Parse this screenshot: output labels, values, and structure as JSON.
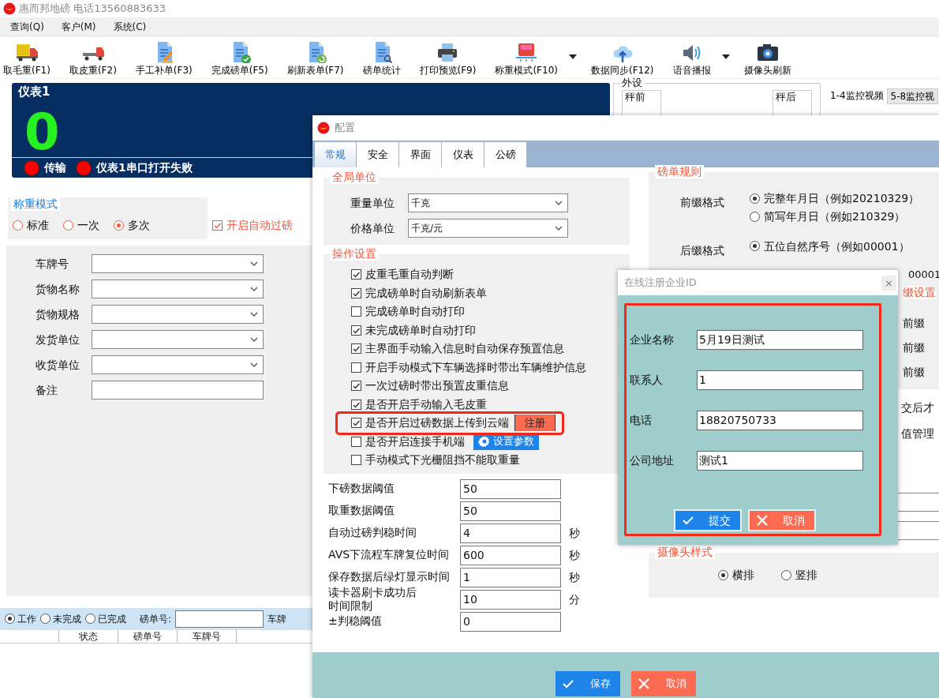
{
  "app": {
    "title": "惠而邦地磅 电话13560883633"
  },
  "menu": [
    "查询(Q)",
    "客户(M)",
    "系统(C)"
  ],
  "toolbar": [
    {
      "label": "取毛重(F1)",
      "kind": "cargo-truck",
      "dropdown": false
    },
    {
      "label": "取皮重(F2)",
      "kind": "flatbed-truck",
      "dropdown": false
    },
    {
      "label": "手工补单(F3)",
      "kind": "doc-pen",
      "dropdown": false
    },
    {
      "label": "完成磅单(F5)",
      "kind": "doc-check",
      "dropdown": false
    },
    {
      "label": "刷新表单(F7)",
      "kind": "doc-refresh",
      "dropdown": false
    },
    {
      "label": "磅单统计",
      "kind": "doc-search",
      "dropdown": false
    },
    {
      "label": "打印预览(F9)",
      "kind": "printer",
      "dropdown": false
    },
    {
      "label": "称重模式(F10)",
      "kind": "truck-front",
      "dropdown": true
    },
    {
      "label": "数据同步(F12)",
      "kind": "cloud-upload",
      "dropdown": false
    },
    {
      "label": "语音播报",
      "kind": "speaker",
      "dropdown": true
    },
    {
      "label": "摄像头刷新",
      "kind": "camera",
      "dropdown": false
    }
  ],
  "meter": {
    "title": "仪表1",
    "reading": "0",
    "indicators": [
      "传输",
      "仪表1串口打开失败"
    ]
  },
  "weigh_mode": {
    "title": "称重模式",
    "options": [
      {
        "label": "标准",
        "selected": false
      },
      {
        "label": "一次",
        "selected": false
      },
      {
        "label": "多次",
        "selected": true
      }
    ]
  },
  "auto_pass": {
    "label": "开启自动过磅",
    "checked": true
  },
  "form": {
    "fields": [
      {
        "label": "车牌号",
        "kind": "combo"
      },
      {
        "label": "货物名称",
        "kind": "combo"
      },
      {
        "label": "货物规格",
        "kind": "combo"
      },
      {
        "label": "发货单位",
        "kind": "combo"
      },
      {
        "label": "收货单位",
        "kind": "combo"
      },
      {
        "label": "备注",
        "kind": "text"
      }
    ]
  },
  "peripherals": {
    "title": "外设",
    "before": "秤前",
    "after": "秤后"
  },
  "video_tabs": [
    {
      "label": "1-4监控视频",
      "selected": true
    },
    {
      "label": "5-8监控视",
      "selected": false
    }
  ],
  "list_filter": {
    "options": [
      {
        "label": "工作",
        "selected": true
      },
      {
        "label": "未完成",
        "selected": false
      },
      {
        "label": "已完成",
        "selected": false
      }
    ],
    "bill_label": "磅单号:",
    "plate_label": "车牌"
  },
  "table": {
    "columns": [
      "",
      "状态",
      "磅单号",
      "车牌号"
    ]
  },
  "config": {
    "title": "配置",
    "tabs": [
      {
        "label": "常规",
        "selected": true
      },
      {
        "label": "安全",
        "selected": false
      },
      {
        "label": "界面",
        "selected": false
      },
      {
        "label": "仪表",
        "selected": false
      },
      {
        "label": "公磅",
        "selected": false
      }
    ],
    "global_units": {
      "title": "全局单位",
      "fields": [
        {
          "label": "重量单位",
          "value": "千克"
        },
        {
          "label": "价格单位",
          "value": "千克/元"
        }
      ]
    },
    "operations": {
      "title": "操作设置",
      "items": [
        {
          "label": "皮重毛重自动判断",
          "checked": true,
          "highlighted": false
        },
        {
          "label": "完成磅单时自动刷新表单",
          "checked": true,
          "highlighted": false
        },
        {
          "label": "完成磅单时自动打印",
          "checked": false,
          "highlighted": false
        },
        {
          "label": "未完成磅单时自动打印",
          "checked": true,
          "highlighted": false
        },
        {
          "label": "主界面手动输入信息时自动保存预置信息",
          "checked": true,
          "highlighted": false
        },
        {
          "label": "开启手动模式下车辆选择时带出车辆维护信息",
          "checked": false,
          "highlighted": false
        },
        {
          "label": "一次过磅时带出预置皮重信息",
          "checked": true,
          "highlighted": false
        },
        {
          "label": "是否开启手动输入毛皮重",
          "checked": true,
          "highlighted": false
        },
        {
          "label": "是否开启过磅数据上传到云端",
          "checked": true,
          "highlighted": true,
          "action": {
            "label": "注册",
            "kind": "register"
          }
        },
        {
          "label": "是否开启连接手机端",
          "checked": false,
          "highlighted": false,
          "action": {
            "label": "设置参数",
            "kind": "settings"
          }
        },
        {
          "label": "手动模式下光栅阻挡不能取重量",
          "checked": false,
          "highlighted": false
        }
      ]
    },
    "thresholds": [
      {
        "label": "下磅数据阈值",
        "value": "50"
      },
      {
        "label": "取重数据阈值",
        "value": "50"
      },
      {
        "label": "自动过磅判稳时间",
        "value": "4",
        "unit": "秒"
      },
      {
        "label": "AVS下流程车牌复位时间",
        "value": "600",
        "unit": "秒"
      },
      {
        "label": "保存数据后绿灯显示时间",
        "value": "1",
        "unit": "秒"
      },
      {
        "label_lines": [
          "读卡器刷卡成功后",
          "时间限制"
        ],
        "value": "10",
        "unit": "分"
      },
      {
        "label": "±判稳阈值",
        "value": "0"
      }
    ],
    "bill_rules": {
      "title": "磅单规则",
      "prefix": {
        "label": "前缀格式",
        "options": [
          {
            "label": "完整年月日（例如20210329）",
            "selected": true
          },
          {
            "label": "简写年月日（例如210329）",
            "selected": false
          }
        ]
      },
      "suffix": {
        "label": "后缀格式",
        "options": [
          {
            "label": "五位自然序号（例如00001）",
            "selected": true
          }
        ]
      },
      "example_tail": "00001"
    },
    "print_prefix": {
      "title": "缀设置",
      "rows": [
        "前缀",
        "前缀",
        "前缀"
      ]
    },
    "notes": [
      "交后才",
      "值管理"
    ],
    "camera_style": {
      "title": "摄像头样式",
      "options": [
        {
          "label": "横排",
          "selected": true
        },
        {
          "label": "竖排",
          "selected": false
        }
      ]
    },
    "save": "保存",
    "cancel": "取消"
  },
  "register_dialog": {
    "title": "在线注册企业ID",
    "close": "×",
    "fields": [
      {
        "label": "企业名称",
        "value": "5月19日测试"
      },
      {
        "label": "联系人",
        "value": "1"
      },
      {
        "label": "电话",
        "value": "18820750733"
      },
      {
        "label": "公司地址",
        "value": "测试1"
      }
    ],
    "submit": "提交",
    "cancel": "取消"
  }
}
